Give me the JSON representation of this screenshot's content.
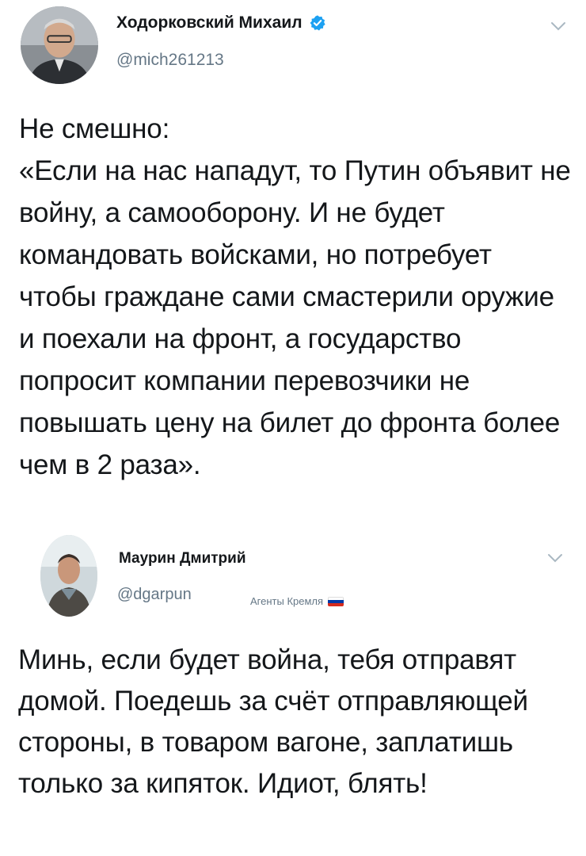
{
  "tweet1": {
    "name": "Ходорковский Михаил",
    "handle": "@mich261213",
    "text": "Не смешно:\n«Если на нас нападут, то Путин объявит не войну, а самооборону. И не будет командовать войсками, но потребует чтобы граждане сами смастерили оружие и поехали на фронт, а государство попросит компании перевозчики не повышать цену на билет до фронта более чем в 2 раза»."
  },
  "tweet2": {
    "name": "Маурин Дмитрий",
    "handle": "@dgarpun",
    "list_tag": "Агенты Кремля",
    "text": "Минь, если будет война, тебя отправят домой. Поедешь за счёт отправляющей стороны, в товаром вагоне, заплатишь только за кипяток. Идиот, блять!"
  },
  "colors": {
    "verified_blue": "#1da1f2",
    "muted_gray": "#657786",
    "text": "#14171a"
  },
  "icons": {
    "verified": "verified-badge-icon",
    "menu": "chevron-down-icon",
    "flag": "russia-flag-icon"
  }
}
